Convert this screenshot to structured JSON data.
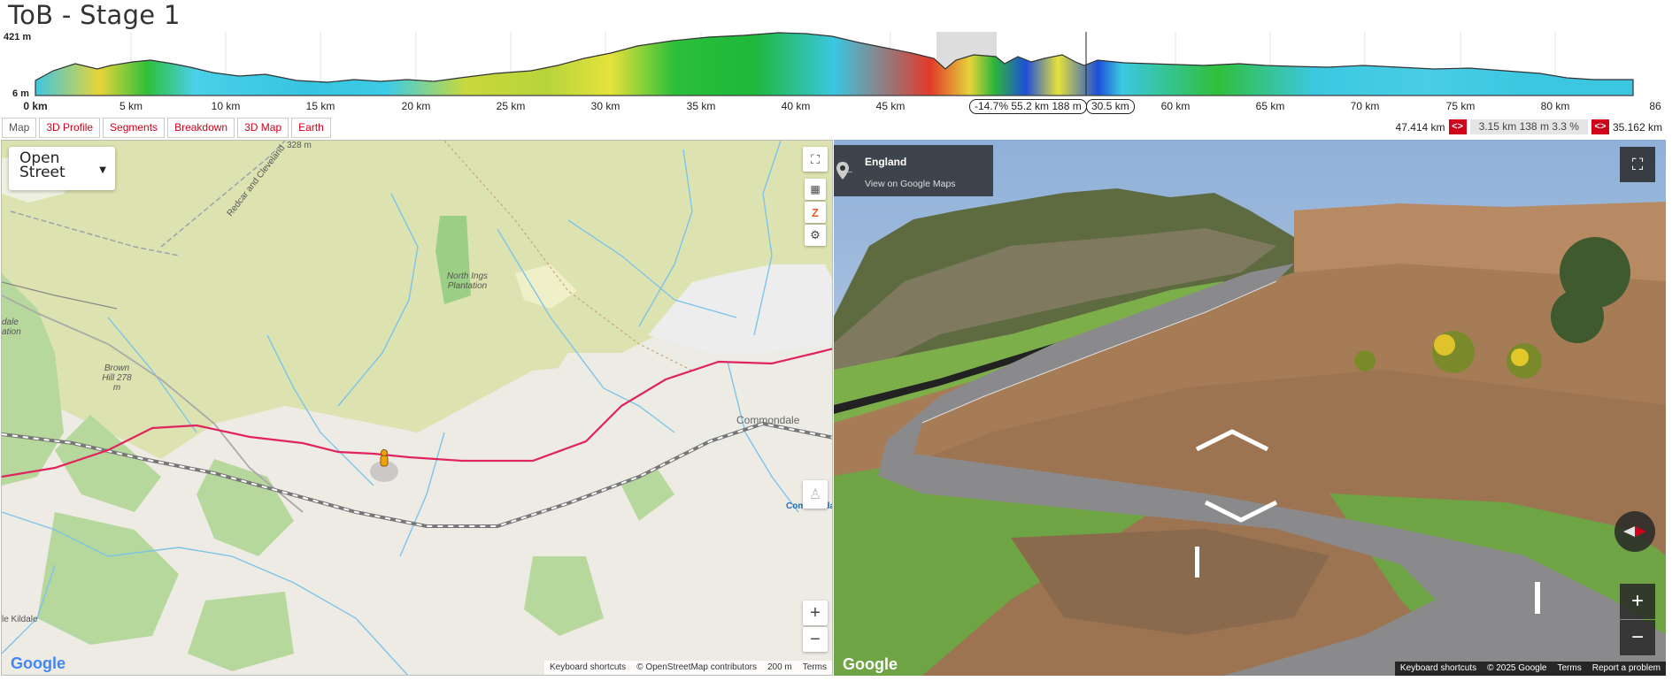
{
  "page": {
    "title": "ToB - Stage 1"
  },
  "profile": {
    "y_max_label": "421 m",
    "y_min_label": "6 m",
    "x_ticks": [
      "0 km",
      "5 km",
      "10 km",
      "15 km",
      "20 km",
      "25 km",
      "30 km",
      "35 km",
      "40 km",
      "45 km",
      "",
      "",
      "60 km",
      "65 km",
      "70 km",
      "75 km",
      "80 km",
      "86"
    ],
    "selection_label": "-14.7% 55.2 km 188 m",
    "cursor_label": "30.5 km"
  },
  "tabs": [
    {
      "label": "Map"
    },
    {
      "label": "3D Profile"
    },
    {
      "label": "Segments"
    },
    {
      "label": "Breakdown"
    },
    {
      "label": "3D Map"
    },
    {
      "label": "Earth"
    }
  ],
  "stats": {
    "left_value": "47.414 km",
    "arrow_label": "<>",
    "segment": "3.15 km 138 m 3.3 %",
    "right_value": "35.162 km"
  },
  "map": {
    "layer_select": "Open Street",
    "labels": {
      "north_ings": "North Ings Plantation",
      "brown_hill": "Brown Hill 278 m",
      "commondale": "Commondale",
      "commondale_station": "Commonda",
      "kildale": "le Kildale",
      "dale": "dale ation",
      "height_328": "328 m",
      "road_name": "Redcar and Cleveland"
    },
    "footer": {
      "shortcuts": "Keyboard shortcuts",
      "attribution": "© OpenStreetMap contributors",
      "scale": "200 m",
      "terms": "Terms"
    },
    "logo": "Google",
    "zoom_in": "+",
    "zoom_out": "−"
  },
  "streetview": {
    "place": "England",
    "link": "View on Google Maps",
    "logo": "Google",
    "footer": {
      "shortcuts": "Keyboard shortcuts",
      "copyright": "© 2025 Google",
      "terms": "Terms",
      "report": "Report a problem"
    },
    "zoom_in": "+",
    "zoom_out": "−"
  },
  "colors": {
    "accent_red": "#d0021b",
    "route_line": "#e0245e",
    "map_bg": "#dde3b0"
  }
}
